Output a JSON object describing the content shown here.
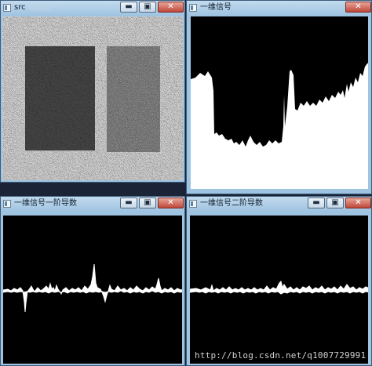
{
  "windows": {
    "src": {
      "title": "src"
    },
    "signal1d": {
      "title": "一维信号"
    },
    "first_derivative": {
      "title": "一维信号一阶导数"
    },
    "second_derivative": {
      "title": "一维信号二阶导数"
    }
  },
  "controls": {
    "minimize": "▬",
    "maximize": "▣",
    "close": "✕"
  },
  "watermark": "http://blog.csdn.net/q1007729991",
  "colors": {
    "titlebar": "#a9cbe7",
    "close": "#c0473a",
    "canvas": "#000000",
    "signal": "#ffffff"
  },
  "icons": [
    "app-icon",
    "minimize-icon",
    "maximize-icon",
    "close-icon"
  ]
}
